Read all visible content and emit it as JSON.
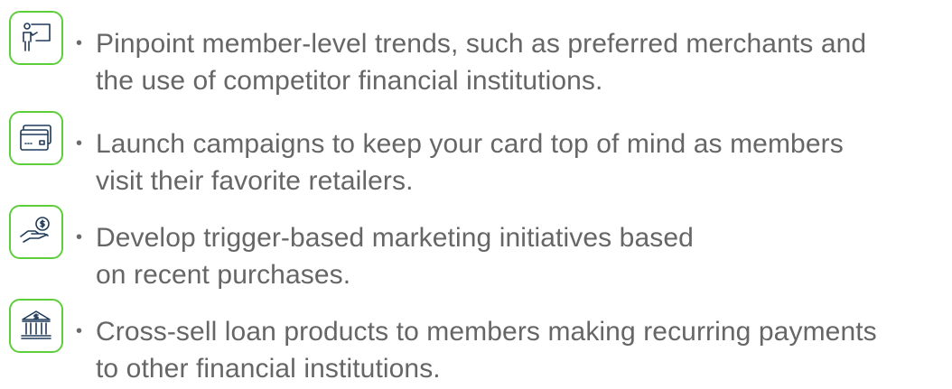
{
  "items": [
    {
      "icon": "presenter-icon",
      "text": "Pinpoint member-level trends, such as preferred merchants and\nthe use of competitor financial institutions."
    },
    {
      "icon": "credit-card-icon",
      "text": "Launch campaigns to keep your card top of mind as members\nvisit their favorite retailers."
    },
    {
      "icon": "hand-coin-icon",
      "text": "Develop trigger-based marketing initiatives based\non recent purchases."
    },
    {
      "icon": "bank-icon",
      "text": "Cross-sell loan products to members making recurring payments\nto other financial institutions."
    }
  ],
  "bullet": "•",
  "colors": {
    "accent": "#5ccf3a",
    "icon_stroke": "#1f3a5a",
    "text": "#666666"
  }
}
